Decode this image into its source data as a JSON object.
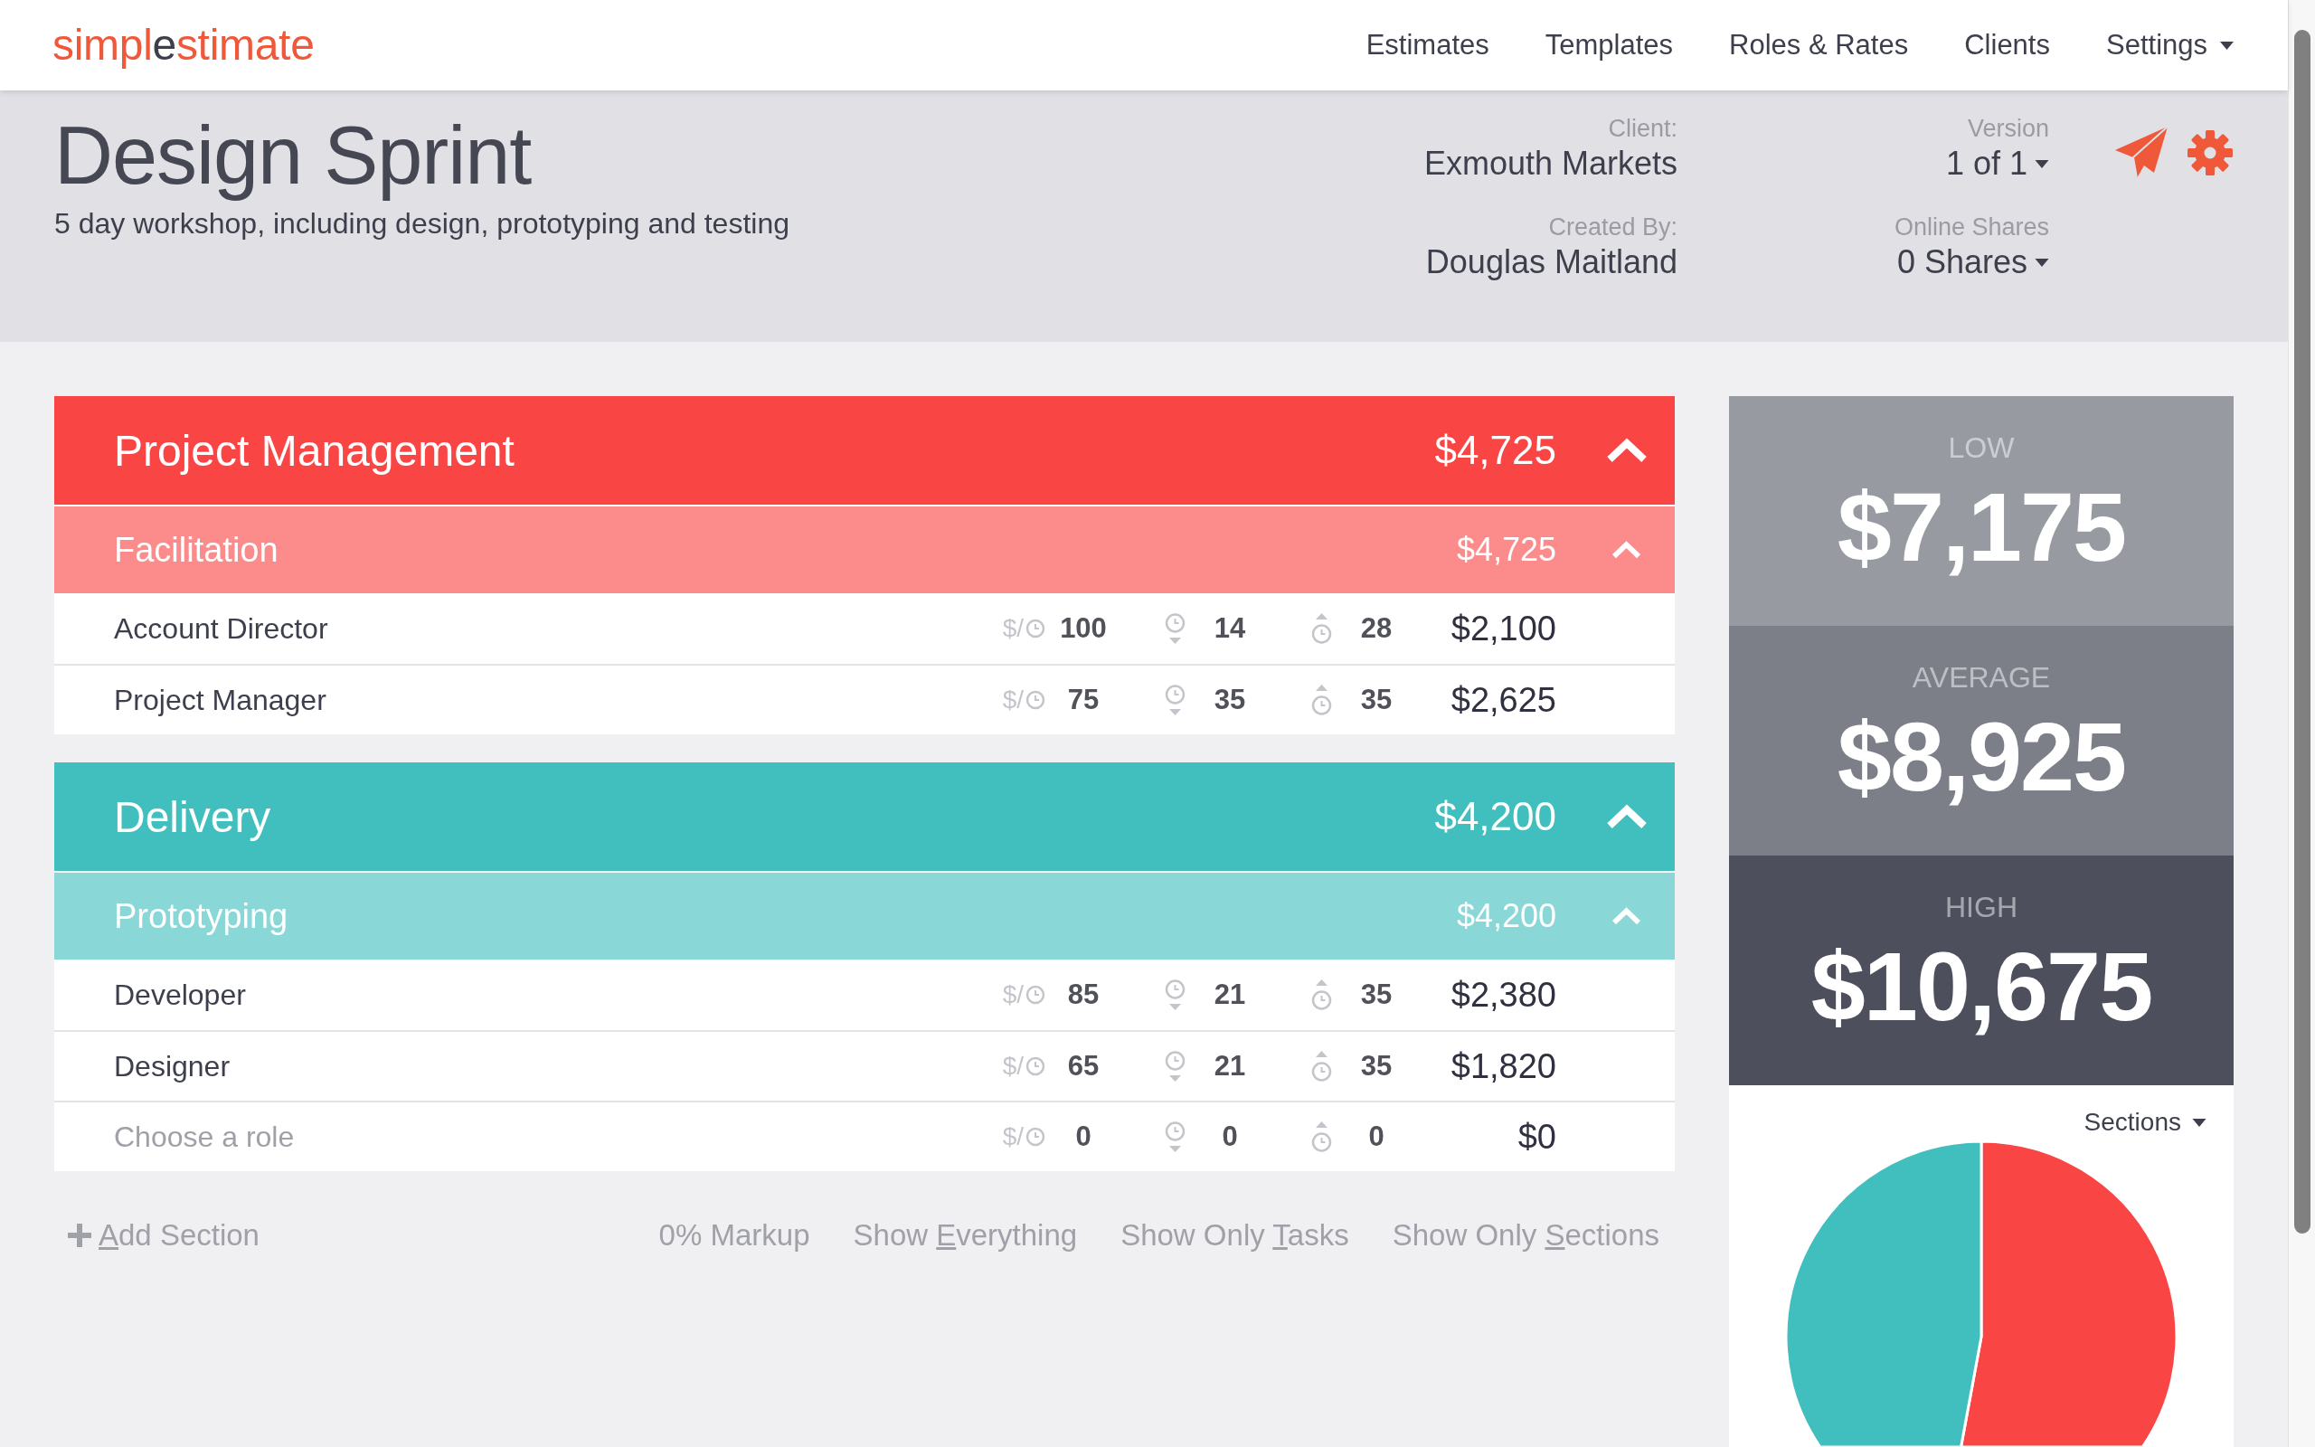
{
  "nav": {
    "logo": [
      {
        "text": "simpl",
        "kind": "brand"
      },
      {
        "text": "e",
        "kind": "plain"
      },
      {
        "text": "stimate",
        "kind": "brand"
      }
    ],
    "links": [
      {
        "label": "Estimates",
        "dropdown": false
      },
      {
        "label": "Templates",
        "dropdown": false
      },
      {
        "label": "Roles & Rates",
        "dropdown": false
      },
      {
        "label": "Clients",
        "dropdown": false
      },
      {
        "label": "Settings",
        "dropdown": true
      }
    ]
  },
  "estimate": {
    "title": "Design Sprint",
    "description": "5 day workshop, including design, prototyping and testing",
    "meta": [
      {
        "label": "Client:",
        "value": "Exmouth Markets",
        "dropdown": false
      },
      {
        "label": "Version",
        "value": "1 of 1",
        "dropdown": true
      },
      {
        "label": "Created By:",
        "value": "Douglas Maitland",
        "dropdown": false
      },
      {
        "label": "Online Shares",
        "value": "0 Shares",
        "dropdown": true
      }
    ]
  },
  "sections": [
    {
      "title": "Project Management",
      "total": "$4,725",
      "color": "#fa4545",
      "expanded": true,
      "tasks": [
        {
          "title": "Facilitation",
          "total": "$4,725",
          "expanded": true,
          "rows": [
            {
              "role": "Account Director",
              "rate_prefix": "$/",
              "rate": "100",
              "low": "14",
              "high": "28",
              "total": "$2,100"
            },
            {
              "role": "Project Manager",
              "rate_prefix": "$/",
              "rate": "75",
              "low": "35",
              "high": "35",
              "total": "$2,625"
            }
          ]
        }
      ]
    },
    {
      "title": "Delivery",
      "total": "$4,200",
      "color": "#40bfbe",
      "expanded": true,
      "tasks": [
        {
          "title": "Prototyping",
          "total": "$4,200",
          "expanded": true,
          "rows": [
            {
              "role": "Developer",
              "rate_prefix": "$/",
              "rate": "85",
              "low": "21",
              "high": "35",
              "total": "$2,380"
            },
            {
              "role": "Designer",
              "rate_prefix": "$/",
              "rate": "65",
              "low": "21",
              "high": "35",
              "total": "$1,820"
            },
            {
              "placeholder": "Choose a role",
              "rate_prefix": "$/",
              "rate": "0",
              "low": "0",
              "high": "0",
              "total": "$0"
            }
          ]
        }
      ]
    }
  ],
  "footer": {
    "add_section": [
      {
        "text": "A",
        "kind": "access_key"
      },
      {
        "text": "dd Section",
        "kind": "plain"
      }
    ],
    "links": [
      [
        {
          "text": "0% Markup",
          "kind": "plain"
        }
      ],
      [
        {
          "text": "Show ",
          "kind": "plain"
        },
        {
          "text": "E",
          "kind": "access_key"
        },
        {
          "text": "verything",
          "kind": "plain"
        }
      ],
      [
        {
          "text": "Show Only ",
          "kind": "plain"
        },
        {
          "text": "T",
          "kind": "access_key"
        },
        {
          "text": "asks",
          "kind": "plain"
        }
      ],
      [
        {
          "text": "Show Only ",
          "kind": "plain"
        },
        {
          "text": "S",
          "kind": "access_key"
        },
        {
          "text": "ections",
          "kind": "plain"
        }
      ]
    ]
  },
  "estimates": [
    {
      "label": "LOW",
      "value": "$7,175",
      "color": "#989aa2"
    },
    {
      "label": "AVERAGE",
      "value": "$8,925",
      "color": "#7c7e88"
    },
    {
      "label": "HIGH",
      "value": "$10,675",
      "color": "#4d4f5c"
    }
  ],
  "chart": {
    "dropdown": "Sections"
  }
}
